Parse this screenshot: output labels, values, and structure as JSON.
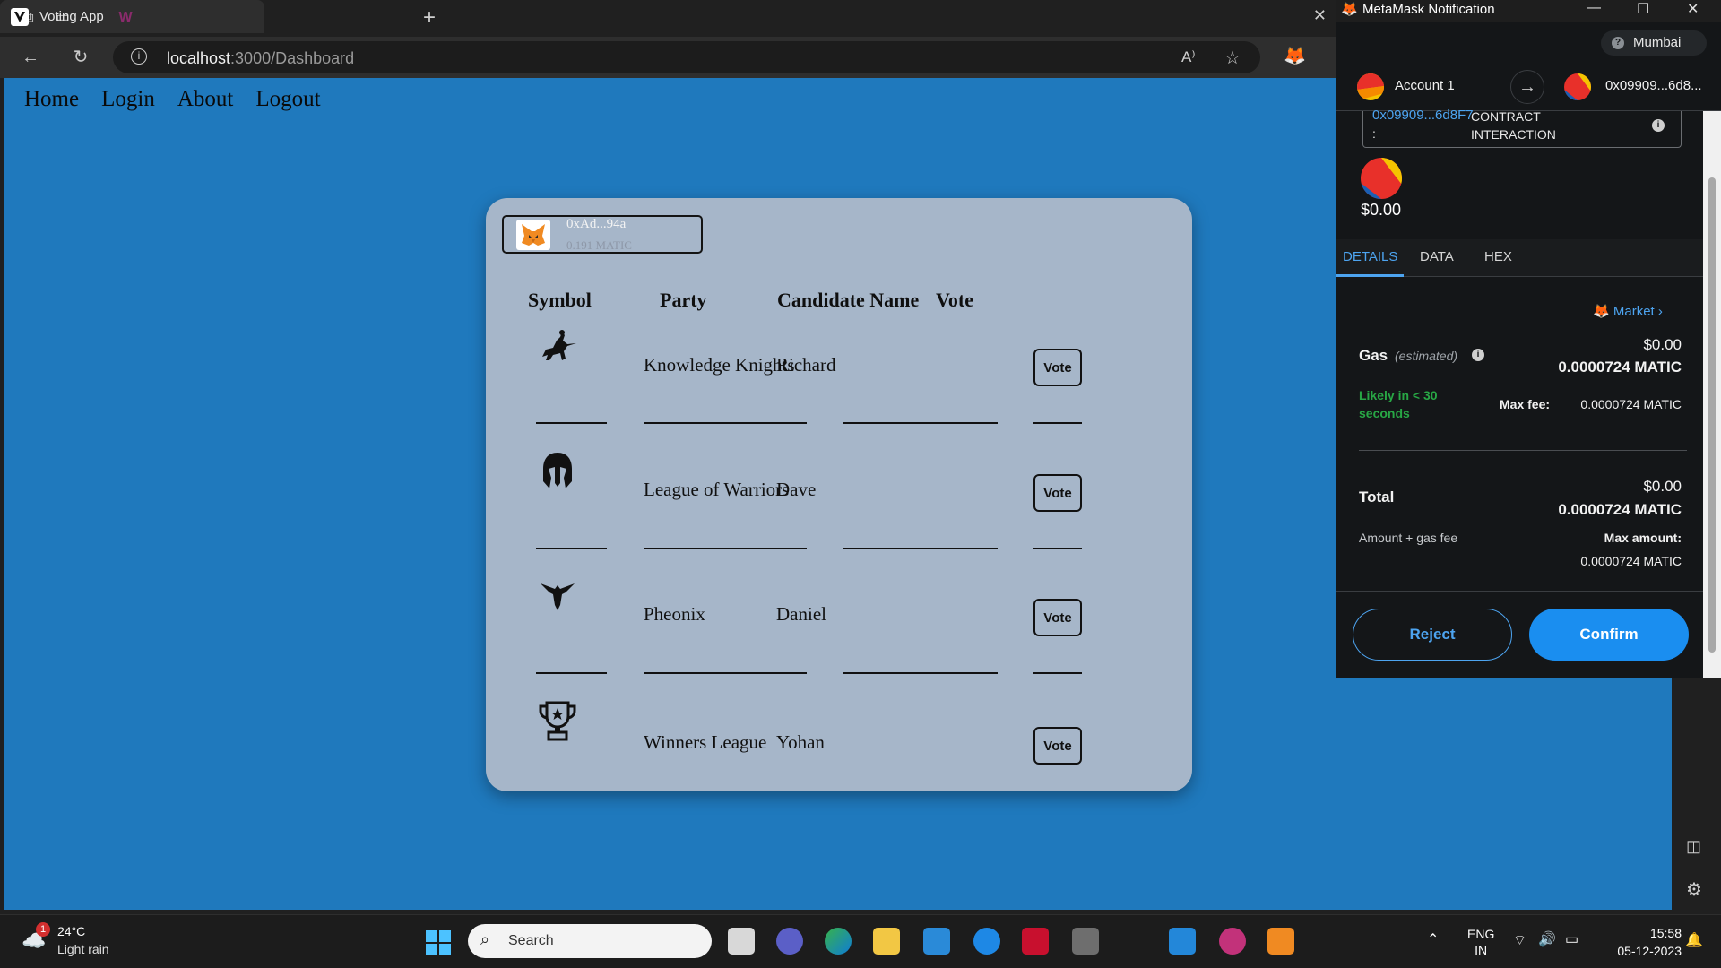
{
  "browser": {
    "tab_title": "Voting App",
    "address_host": "localhost",
    "address_path": ":3000/Dashboard"
  },
  "nav": {
    "items": [
      "Home",
      "Login",
      "About",
      "Logout"
    ]
  },
  "wallet": {
    "address": "0xAd...94a",
    "balance": "0.191 MATIC"
  },
  "table": {
    "headers": [
      "Symbol",
      "Party",
      "Candidate Name",
      "Vote"
    ],
    "rows": [
      {
        "party": "Knowledge Knights",
        "candidate": "Richard",
        "vote": "Vote",
        "icon": "knight-icon"
      },
      {
        "party": "League of Warriors",
        "candidate": "Dave",
        "vote": "Vote",
        "icon": "spartan-helmet-icon"
      },
      {
        "party": "Pheonix",
        "candidate": "Daniel",
        "vote": "Vote",
        "icon": "phoenix-icon"
      },
      {
        "party": "Winners League",
        "candidate": "Yohan",
        "vote": "Vote",
        "icon": "trophy-icon"
      }
    ]
  },
  "metamask": {
    "window_title": "MetaMask Notification",
    "network": "Mumbai",
    "from_account": "Account 1",
    "to_address": "0x09909...6d8...",
    "contract_address": "0x09909...6d8F7",
    "contract_colon": ":",
    "contract_type": "CONTRACT INTERACTION",
    "amount": "$0.00",
    "tabs": [
      "DETAILS",
      "DATA",
      "HEX"
    ],
    "market_label": "Market",
    "gas": {
      "label": "Gas",
      "estimated": "(estimated)",
      "usd": "$0.00",
      "matic": "0.0000724 MATIC",
      "likely": "Likely in < 30 seconds",
      "max_fee_label": "Max fee:",
      "max_fee_value": "0.0000724 MATIC"
    },
    "total": {
      "label": "Total",
      "usd": "$0.00",
      "matic": "0.0000724 MATIC",
      "sub_label": "Amount + gas fee",
      "max_amount_label": "Max amount:",
      "max_amount_value": "0.0000724 MATIC"
    },
    "reject_label": "Reject",
    "confirm_label": "Confirm"
  },
  "taskbar": {
    "weather_temp": "24°C",
    "weather_desc": "Light rain",
    "weather_badge": "1",
    "search_placeholder": "Search",
    "lang_line1": "ENG",
    "lang_line2": "IN",
    "time": "15:58",
    "date": "05-12-2023"
  },
  "colors": {
    "page_bg": "#1f79bd",
    "card_bg": "#a6b6c9",
    "metamask_blue": "#1a8ef0",
    "likely_green": "#28a745"
  }
}
